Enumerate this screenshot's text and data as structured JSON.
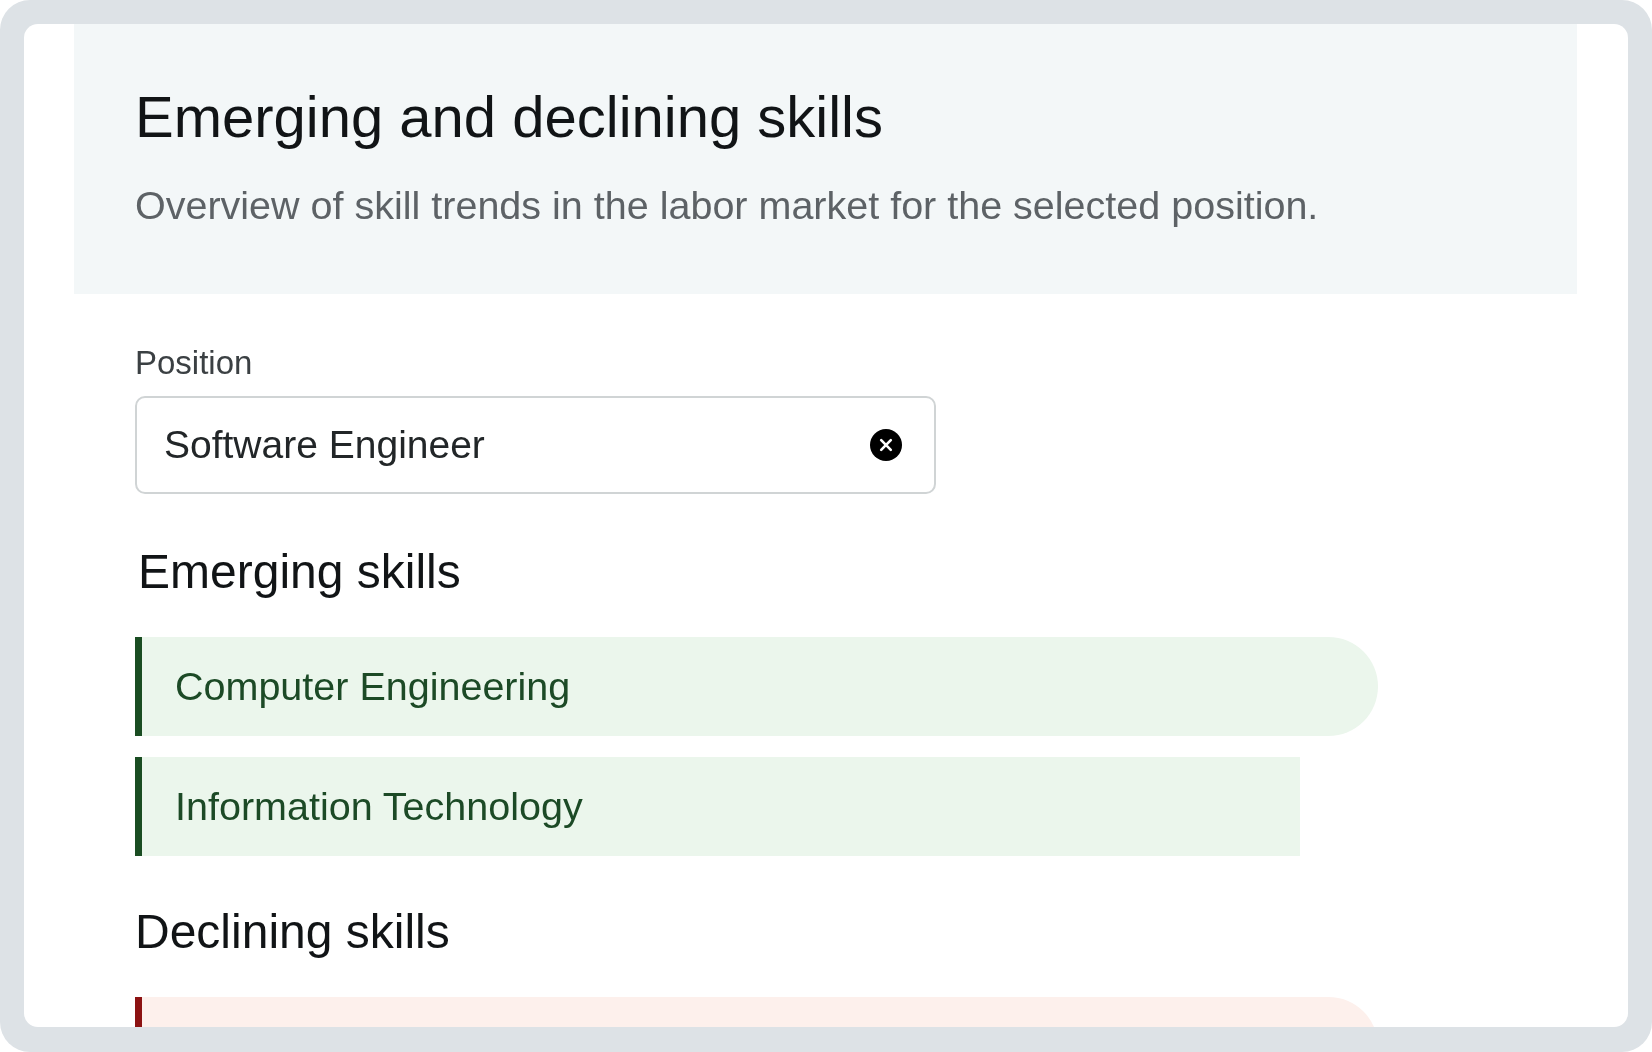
{
  "header": {
    "title": "Emerging and declining skills",
    "subtitle": "Overview of skill trends in the labor market for the selected position."
  },
  "position_field": {
    "label": "Position",
    "value": "Software Engineer"
  },
  "sections": [
    {
      "title": "Emerging skills",
      "kind": "emerging",
      "skills": [
        {
          "label": "Computer Engineering",
          "kind": "pill"
        },
        {
          "label": "Information Technology",
          "kind": "bar"
        }
      ]
    },
    {
      "title": "Declining skills",
      "kind": "declining",
      "skills": [
        {
          "kind": "pill"
        }
      ]
    }
  ]
}
